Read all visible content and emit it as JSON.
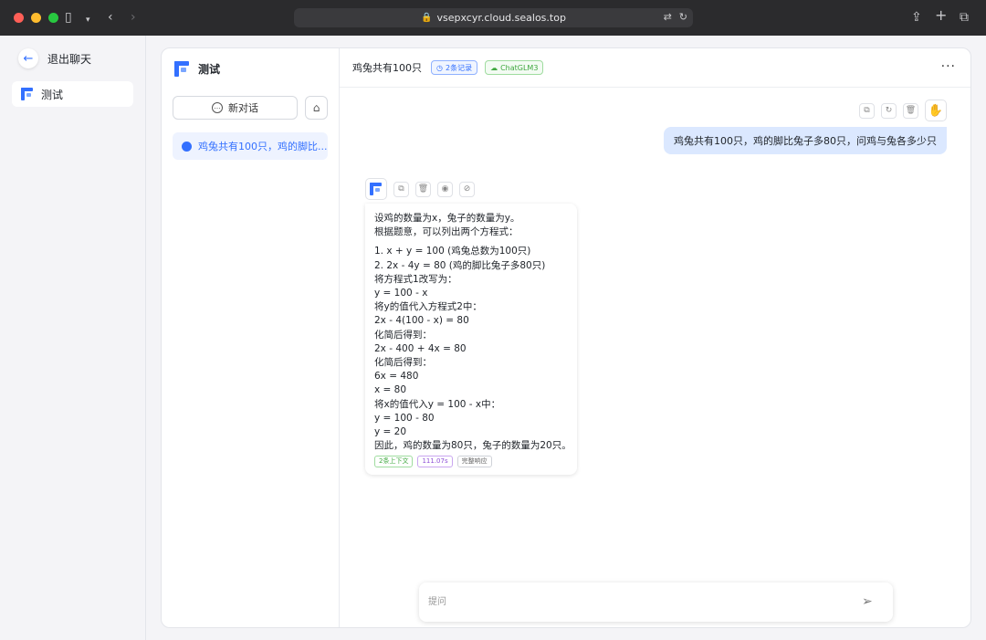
{
  "browser": {
    "url": "vsepxcyr.cloud.sealos.top"
  },
  "sidebar": {
    "exit_label": "退出聊天",
    "app_name": "测试"
  },
  "history": {
    "title": "测试",
    "new_chat_label": "新对话",
    "items": [
      {
        "label": "鸡兔共有100只，鸡的脚比..."
      }
    ]
  },
  "chat": {
    "title": "鸡兔共有100只",
    "record_tag": "2条记录",
    "model_tag": "ChatGLM3",
    "user_message": "鸡兔共有100只，鸡的脚比兔子多80只，问鸡与兔各多少只",
    "ai_message": {
      "intro": [
        "设鸡的数量为x，兔子的数量为y。",
        "根据题意，可以列出两个方程式："
      ],
      "list": [
        "1.  x + y = 100 (鸡兔总数为100只)",
        "2.  2x - 4y = 80 (鸡的脚比兔子多80只)"
      ],
      "steps": [
        "将方程式1改写为：",
        "y = 100 - x",
        "将y的值代入方程式2中：",
        "2x - 4(100 - x) = 80",
        "化简后得到：",
        "2x - 400 + 4x = 80",
        "化简后得到：",
        "6x = 480",
        "x = 80",
        "将x的值代入y = 100 - x中：",
        "y = 100 - 80",
        "y = 20",
        "因此，鸡的数量为80只，兔子的数量为20只。"
      ],
      "tags": [
        "2条上下文",
        "111.07s",
        "完整响应"
      ]
    },
    "input_placeholder": "提问"
  },
  "colors": {
    "accent": "#3370ff",
    "user_bubble": "#dbe8ff"
  }
}
